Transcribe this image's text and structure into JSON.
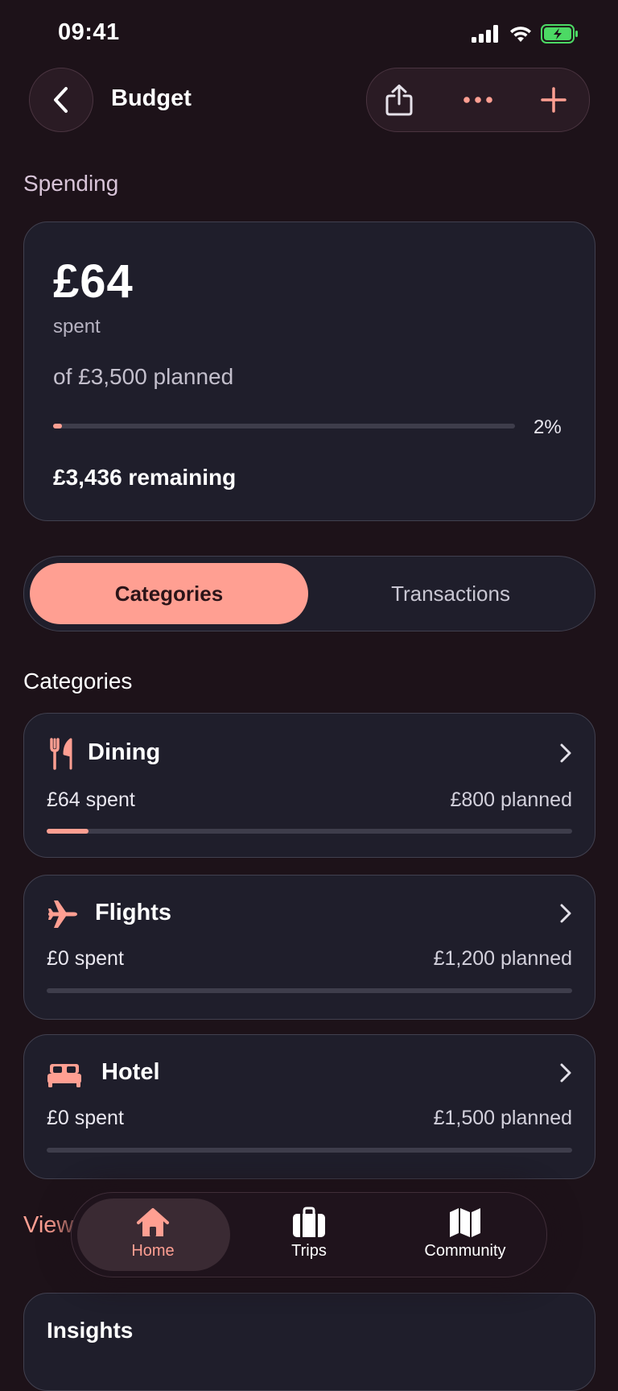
{
  "status_bar": {
    "time": "09:41"
  },
  "header": {
    "title": "Budget"
  },
  "section_label": "Spending",
  "summary": {
    "amount": "£64",
    "spent_label": "spent",
    "planned_label": "of £3,500 planned",
    "progress_percent": "2%",
    "progress_fraction": 0.02,
    "remaining": "£3,436 remaining"
  },
  "segments": {
    "active": "Categories",
    "inactive": "Transactions"
  },
  "categories_heading": "Categories",
  "categories": [
    {
      "name": "Dining",
      "icon": "fork-knife-icon",
      "spent": "£64 spent",
      "planned": "£800 planned",
      "progress_fraction": 0.08
    },
    {
      "name": "Flights",
      "icon": "airplane-icon",
      "spent": "£0 spent",
      "planned": "£1,200 planned",
      "progress_fraction": 0
    },
    {
      "name": "Hotel",
      "icon": "bed-icon",
      "spent": "£0 spent",
      "planned": "£1,500 planned",
      "progress_fraction": 0
    }
  ],
  "view_all_label": "View",
  "tabbar": {
    "home": "Home",
    "trips": "Trips",
    "community": "Community"
  },
  "insights": {
    "title": "Insights"
  },
  "colors": {
    "accent": "#ff9f92",
    "background": "#1d1219",
    "card": "#1f1e2b",
    "battery": "#4cd964"
  }
}
